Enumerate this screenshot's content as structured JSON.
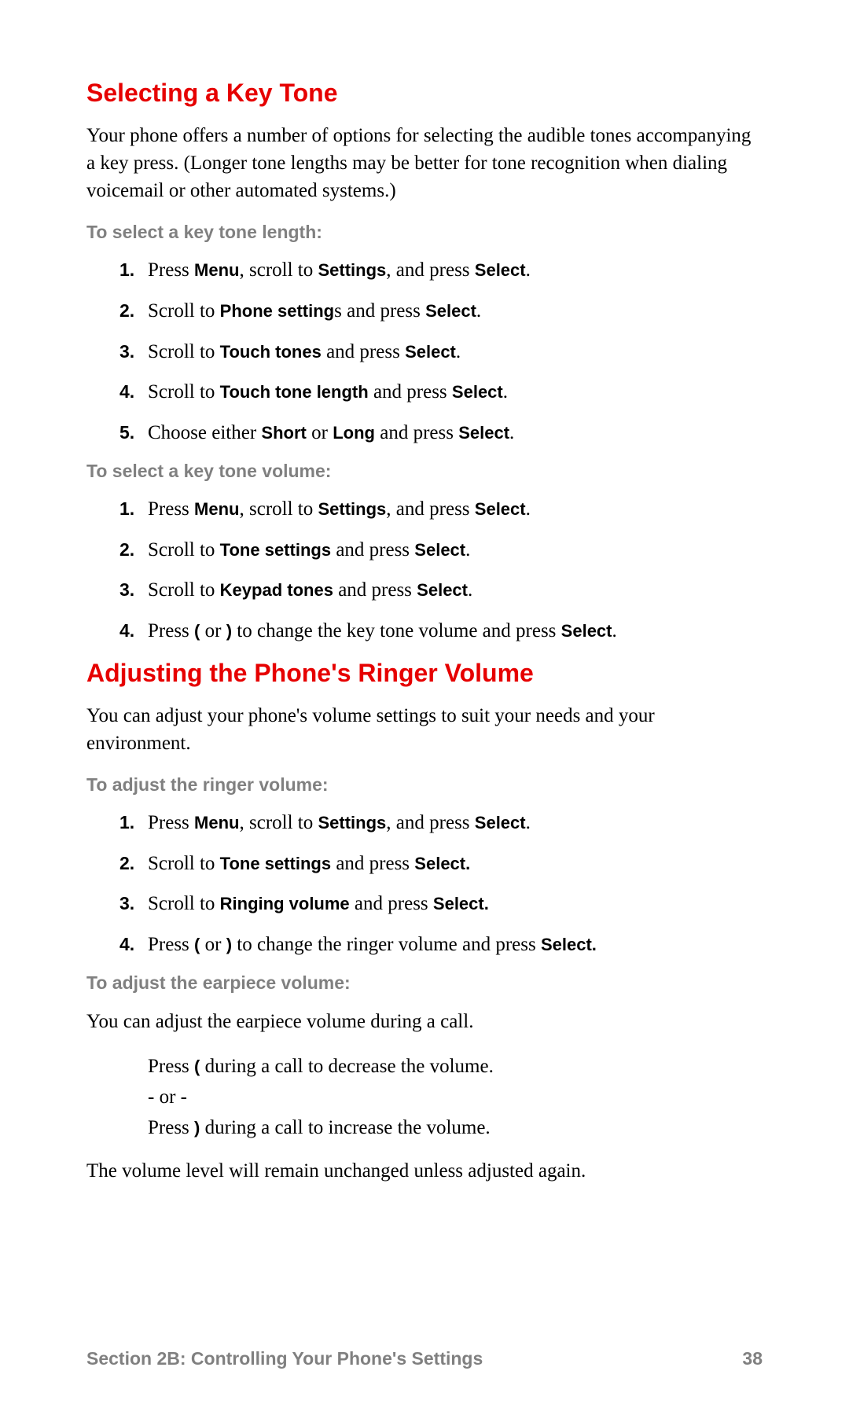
{
  "section1": {
    "heading": "Selecting a Key Tone",
    "intro": "Your phone offers a number of options for selecting the audible tones accompanying a key press. (Longer tone lengths may be better for tone recognition when dialing voicemail or other automated systems.)",
    "sub1_title": "To select a key tone length:",
    "steps1": [
      {
        "pre": "Press ",
        "b1": "Menu",
        "mid1": ", scroll to ",
        "b2": "Settings",
        "mid2": ", and press ",
        "b3": "Select",
        "tail": "."
      },
      {
        "pre": "Scroll to ",
        "b1": "Phone setting",
        "mid1": "s and press ",
        "b2": "Select",
        "tail": "."
      },
      {
        "pre": "Scroll to ",
        "b1": "Touch tones",
        "mid1": " and press ",
        "b2": "Select",
        "tail": "."
      },
      {
        "pre": "Scroll to ",
        "b1": "Touch tone length",
        "mid1": " and press ",
        "b2": "Select",
        "tail": "."
      },
      {
        "pre": "Choose either ",
        "b1": "Short",
        "mid1": " or ",
        "b2": "Long",
        "mid2": " and press ",
        "b3": "Select",
        "tail": "."
      }
    ],
    "sub2_title": "To select a key tone volume:",
    "steps2": [
      {
        "pre": "Press ",
        "b1": "Menu",
        "mid1": ", scroll to ",
        "b2": "Settings",
        "mid2": ", and press ",
        "b3": "Select",
        "tail": "."
      },
      {
        "pre": "Scroll to ",
        "b1": "Tone settings",
        "mid1": " and press ",
        "b2": "Select",
        "tail": "."
      },
      {
        "pre": "Scroll to ",
        "b1": "Keypad tones",
        "mid1": " and press ",
        "b2": "Select",
        "tail": "."
      },
      {
        "pre": "Press ",
        "paren1": "(",
        "mid1": " or ",
        "paren2": ")",
        "mid2": " to change the key tone volume and press ",
        "b1": "Select",
        "tail": "."
      }
    ]
  },
  "section2": {
    "heading": "Adjusting the Phone's Ringer Volume",
    "intro": "You can adjust your phone's volume settings to suit your needs and your environment.",
    "sub1_title": "To adjust the ringer volume:",
    "steps1": [
      {
        "pre": "Press ",
        "b1": "Menu",
        "mid1": ", scroll to ",
        "b2": "Settings",
        "mid2": ", and press ",
        "b3": "Select",
        "tail": "."
      },
      {
        "pre": "Scroll to ",
        "b1": "Tone settings",
        "mid1": " and press ",
        "b2": "Select.",
        "tail": ""
      },
      {
        "pre": "Scroll to ",
        "b1": "Ringing volume",
        "mid1": " and press ",
        "b2": "Select.",
        "tail": ""
      },
      {
        "pre": "Press ",
        "paren1": "(",
        "mid1": " or ",
        "paren2": ")",
        "mid2": " to change the ringer volume and press ",
        "b1": "Select.",
        "tail": ""
      }
    ],
    "sub2_title": "To adjust the earpiece volume:",
    "earpiece_intro": "You can adjust the earpiece volume during a call.",
    "earpiece_lines": {
      "l1_pre": "Press ",
      "l1_paren": "(",
      "l1_tail": " during a call to decrease the volume.",
      "or": "- or -",
      "l2_pre": "Press ",
      "l2_paren": ")",
      "l2_tail": " during a call to increase the volume."
    },
    "earpiece_outro": "The volume level will remain unchanged unless adjusted again."
  },
  "footer": {
    "section_label": "Section 2B: Controlling Your Phone's Settings",
    "page_number": "38"
  }
}
